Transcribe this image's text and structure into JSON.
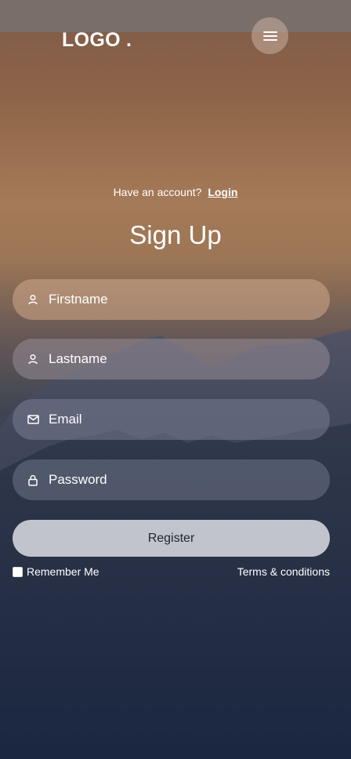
{
  "header": {
    "logo": "LOGO .",
    "menu_icon": "hamburger-menu-icon"
  },
  "auth": {
    "have_account_text": "Have an account?",
    "login_link": "Login"
  },
  "form": {
    "title": "Sign Up",
    "firstname": {
      "placeholder": "Firstname",
      "value": "",
      "icon": "user-icon"
    },
    "lastname": {
      "placeholder": "Lastname",
      "value": "",
      "icon": "user-icon"
    },
    "email": {
      "placeholder": "Email",
      "value": "",
      "icon": "envelope-icon"
    },
    "password": {
      "placeholder": "Password",
      "value": "",
      "icon": "lock-icon"
    },
    "register_label": "Register",
    "remember_label": "Remember Me",
    "terms_label": "Terms & conditions"
  },
  "colors": {
    "button_bg": "#c1c4cb",
    "button_text": "#1d2535",
    "text": "#ffffff"
  }
}
